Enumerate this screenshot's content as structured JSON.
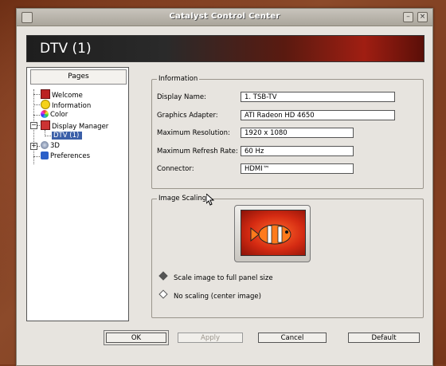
{
  "window": {
    "title": "Catalyst Control Center"
  },
  "banner": {
    "title": "DTV (1)"
  },
  "pages": {
    "header": "Pages",
    "items": [
      {
        "label": "Welcome",
        "icon": "welcome-icon"
      },
      {
        "label": "Information",
        "icon": "information-icon"
      },
      {
        "label": "Color",
        "icon": "color-icon"
      },
      {
        "label": "Display Manager",
        "icon": "display-manager-icon"
      },
      {
        "label": "DTV (1)",
        "icon": "dtv-icon",
        "selected": true
      },
      {
        "label": "3D",
        "icon": "3d-icon"
      },
      {
        "label": "Preferences",
        "icon": "preferences-icon"
      }
    ]
  },
  "information": {
    "legend": "Information",
    "display_name_label": "Display Name:",
    "display_name_value": "1. TSB-TV",
    "graphics_adapter_label": "Graphics Adapter:",
    "graphics_adapter_value": "ATI Radeon HD 4650",
    "max_resolution_label": "Maximum Resolution:",
    "max_resolution_value": "1920 x 1080",
    "max_refresh_label": "Maximum Refresh Rate:",
    "max_refresh_value": "60 Hz",
    "connector_label": "Connector:",
    "connector_value": "HDMI™"
  },
  "image_scaling": {
    "legend": "Image Scaling",
    "option_full": "Scale image to full panel size",
    "option_center": "No scaling (center image)",
    "selected": "option_full"
  },
  "buttons": {
    "ok": "OK",
    "apply": "Apply",
    "cancel": "Cancel",
    "default": "Default"
  }
}
